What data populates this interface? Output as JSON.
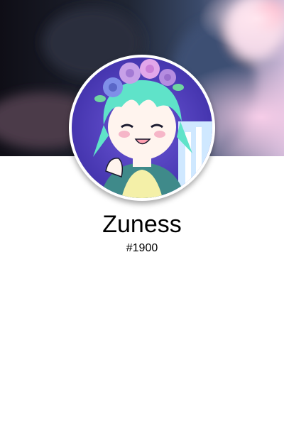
{
  "profile": {
    "username": "Zuness",
    "discriminator": "#1900",
    "avatar_icon": "anime-avatar-flower-crown",
    "banner_icon": "blurred-banner-image"
  },
  "colors": {
    "banner_dark": "#1c1f33",
    "banner_pink": "#f2c4e0",
    "avatar_purple": "#5a4cc9",
    "avatar_hair": "#5fe3c9",
    "avatar_skin": "#fff4ee",
    "text": "#000000",
    "background": "#ffffff"
  }
}
